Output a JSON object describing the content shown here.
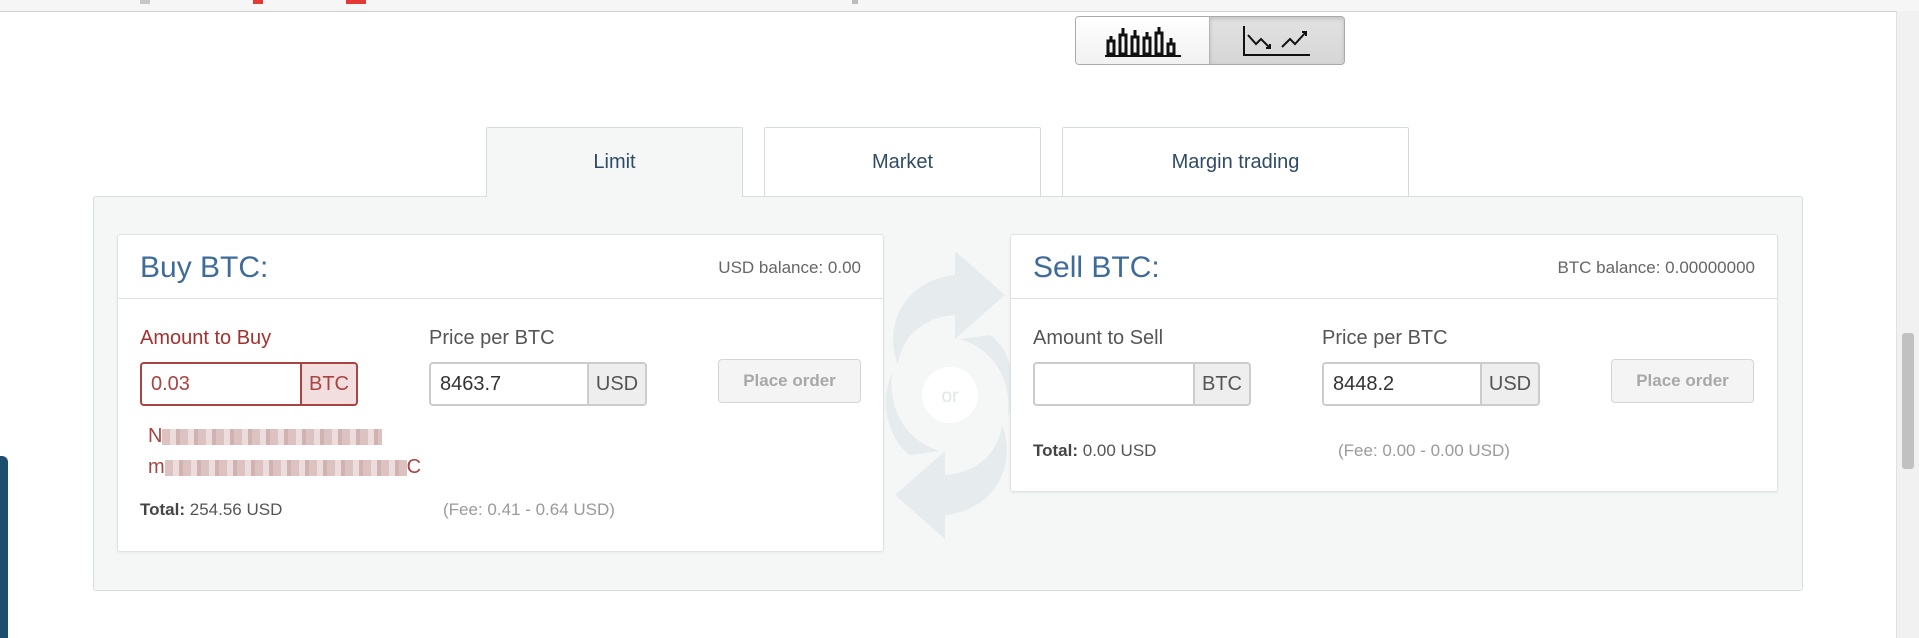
{
  "chart_toggle": {
    "candles_icon": "candlestick-chart-icon",
    "line_icon": "line-chart-icon"
  },
  "tabs": [
    {
      "label": "Limit"
    },
    {
      "label": "Market"
    },
    {
      "label": "Margin trading"
    }
  ],
  "separator": {
    "label": "or"
  },
  "buy": {
    "title": "Buy BTC:",
    "balance": "USD balance: 0.00",
    "amount_label": "Amount to Buy",
    "amount_value": "0.03",
    "amount_unit": "BTC",
    "price_label": "Price per BTC",
    "price_value": "8463.7",
    "price_unit": "USD",
    "place_order": "Place order",
    "error_line1_start": "N",
    "error_line2_start": "m",
    "error_line2_end": "C",
    "total_label": "Total:",
    "total_value": "254.56 USD",
    "fee": "(Fee: 0.41 - 0.64 USD)"
  },
  "sell": {
    "title": "Sell BTC:",
    "balance": "BTC balance: 0.00000000",
    "amount_label": "Amount to Sell",
    "amount_value": "",
    "amount_unit": "BTC",
    "price_label": "Price per BTC",
    "price_value": "8448.2",
    "price_unit": "USD",
    "place_order": "Place order",
    "total_label": "Total:",
    "total_value": "0.00 USD",
    "fee": "(Fee: 0.00 - 0.00 USD)"
  },
  "colors": {
    "accent_blue": "#3e6b99",
    "error_red": "#a94442",
    "panel_bg": "#f5f7f7"
  }
}
